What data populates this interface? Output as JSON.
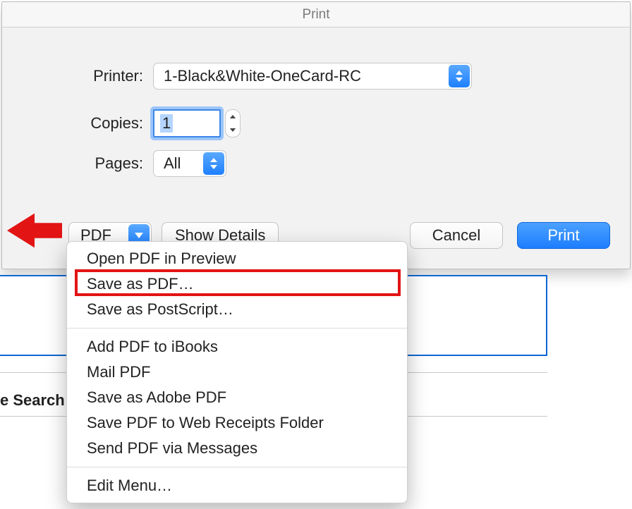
{
  "title": "Print",
  "labels": {
    "printer": "Printer:",
    "copies": "Copies:",
    "pages": "Pages:"
  },
  "printer_value": "1-Black&White-OneCard-RC",
  "copies_value": "1",
  "pages_value": "All",
  "buttons": {
    "pdf": "PDF",
    "show_details": "Show Details",
    "cancel": "Cancel",
    "print": "Print"
  },
  "pdf_menu": {
    "open_preview": "Open PDF in Preview",
    "save_as_pdf": "Save as PDF…",
    "save_as_ps": "Save as PostScript…",
    "add_ibooks": "Add PDF to iBooks",
    "mail_pdf": "Mail PDF",
    "save_adobe": "Save as Adobe PDF",
    "save_web": "Save PDF to Web Receipts Folder",
    "send_messages": "Send PDF via Messages",
    "edit_menu": "Edit Menu…"
  },
  "background": {
    "search_label": "e Search"
  }
}
